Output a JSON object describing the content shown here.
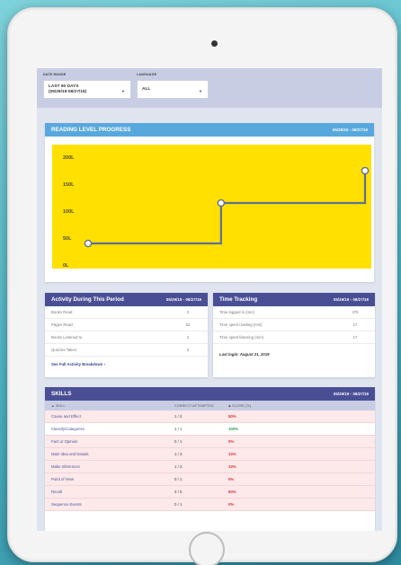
{
  "filters": {
    "date_range": {
      "label": "DATE RANGE",
      "value_line1": "LAST 90 DAYS",
      "value_line2": "(05/29/19-08/27/19)"
    },
    "language": {
      "label": "LANGUAGE",
      "value": "ALL"
    }
  },
  "reading_progress": {
    "title": "READING LEVEL PROGRESS",
    "date": "05/29/19 - 08/27/19"
  },
  "chart_data": {
    "type": "line",
    "title": "READING LEVEL PROGRESS",
    "y_ticks": [
      "0L",
      "50L",
      "100L",
      "150L",
      "200L"
    ],
    "ylim": [
      0,
      210
    ],
    "line_style": "step",
    "points": [
      {
        "x": 0.0,
        "y": 40
      },
      {
        "x": 0.48,
        "y": 115
      },
      {
        "x": 1.0,
        "y": 175
      }
    ],
    "colors": {
      "background": "#ffe000",
      "line": "#5f6f95",
      "marker_fill": "#ffffff"
    },
    "grid": false,
    "legend": "none"
  },
  "activity": {
    "title": "Activity During This Period",
    "date": "05/29/19 - 08/27/19",
    "rows": [
      {
        "label": "Books Read",
        "value": "3"
      },
      {
        "label": "Pages Read",
        "value": "52"
      },
      {
        "label": "Books Listened to",
        "value": "2"
      },
      {
        "label": "Quizzes Taken",
        "value": "3"
      }
    ],
    "link": "See Full Activity Breakdown  ›"
  },
  "time_tracking": {
    "title": "Time Tracking",
    "date": "05/29/19 - 08/27/19",
    "rows": [
      {
        "label": "Time logged in (min)",
        "value": "375"
      },
      {
        "label": "Time spent reading (min)",
        "value": "17"
      },
      {
        "label": "Time spent listening (min)",
        "value": "17"
      }
    ],
    "last_login": "Last login: August 21, 2019"
  },
  "skills": {
    "title": "SKILLS",
    "date": "05/29/19 - 08/27/19",
    "headers": {
      "skill": "▲ SKILL",
      "correct": "CORRECT/ATTEMPTED",
      "score": "◆ SCORE (%)"
    },
    "rows": [
      {
        "skill": "Cause and Effect",
        "correct": "1 / 2",
        "score": "50%",
        "color": "#d9343a",
        "bg": "#fde8ea"
      },
      {
        "skill": "Classify/Categorize",
        "correct": "1 / 1",
        "score": "100%",
        "color": "#27a24a",
        "bg": "#ffffff"
      },
      {
        "skill": "Fact or Opinion",
        "correct": "0 / 1",
        "score": "0%",
        "color": "#d9343a",
        "bg": "#fde8ea"
      },
      {
        "skill": "Main Idea and Details",
        "correct": "1 / 3",
        "score": "33%",
        "color": "#d9343a",
        "bg": "#fde8ea"
      },
      {
        "skill": "Make Inferences",
        "correct": "1 / 3",
        "score": "33%",
        "color": "#d9343a",
        "bg": "#fde8ea"
      },
      {
        "skill": "Point of View",
        "correct": "0 / 1",
        "score": "0%",
        "color": "#d9343a",
        "bg": "#fde8ea"
      },
      {
        "skill": "Recall",
        "correct": "3 / 5",
        "score": "60%",
        "color": "#d9343a",
        "bg": "#fde8ea"
      },
      {
        "skill": "Sequence Events",
        "correct": "0 / 1",
        "score": "0%",
        "color": "#d9343a",
        "bg": "#fde8ea"
      }
    ]
  }
}
